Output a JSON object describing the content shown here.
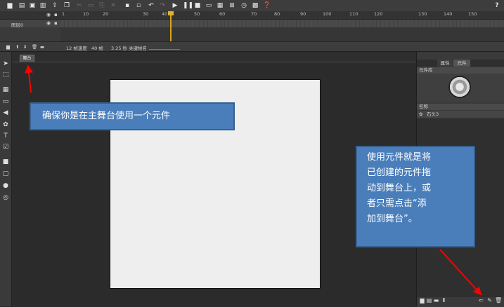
{
  "toolbar": {
    "help_icon": "?"
  },
  "timeline": {
    "ruler_ticks": [
      "1",
      "10",
      "20",
      "30",
      "40",
      "50",
      "60",
      "70",
      "80",
      "90",
      "100",
      "110",
      "120",
      "130",
      "140",
      "150"
    ],
    "layer_name": "图层0",
    "status": {
      "frame_rate": "12 帧速度",
      "frames": "40 帧",
      "seconds": "3.25 秒",
      "keyframe_label": "关键帧名"
    },
    "playhead_color": "#d8a420"
  },
  "stage": {
    "tab_label": "舞台",
    "canvas_color": "#eeeeee"
  },
  "right_panel": {
    "tabs": [
      "属性",
      "元件"
    ],
    "library_title": "元件库",
    "list_header": "名称",
    "list_item": "石头3"
  },
  "callouts": {
    "callout1": "确保你是在主舞台使用一个元件",
    "callout2_lines": [
      "使用元件就是将",
      "已创建的元件拖",
      "动到舞台上，或",
      "者只需点击“添",
      "加到舞台”。"
    ],
    "color": "#4a7ebb"
  },
  "annotation_color": "#ff0000"
}
